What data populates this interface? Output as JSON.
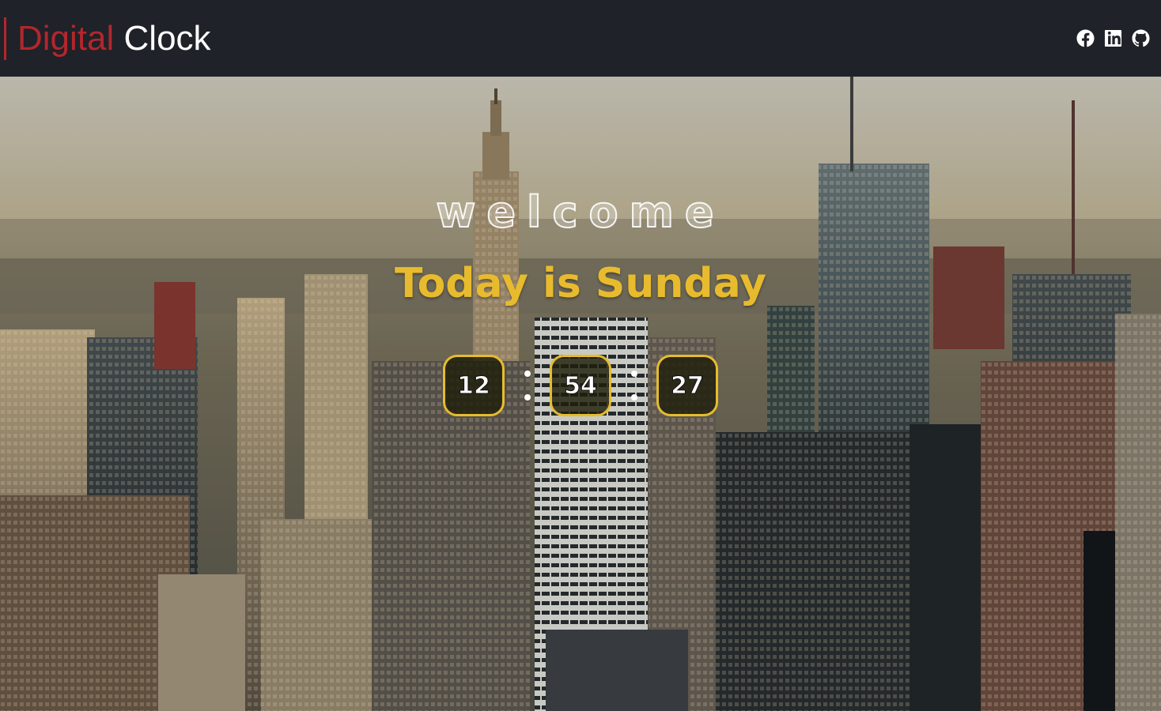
{
  "navbar": {
    "brand_part1": "Digital",
    "brand_part2": "Clock",
    "accent_color": "#b3262d",
    "social": [
      {
        "icon": "facebook-icon"
      },
      {
        "icon": "linkedin-icon"
      },
      {
        "icon": "github-icon"
      }
    ]
  },
  "hero": {
    "welcome": "welcome",
    "today": "Today is Sunday",
    "clock": {
      "hours": "12",
      "minutes": "54",
      "seconds": "27"
    },
    "accent_color": "#e8bb2e"
  }
}
